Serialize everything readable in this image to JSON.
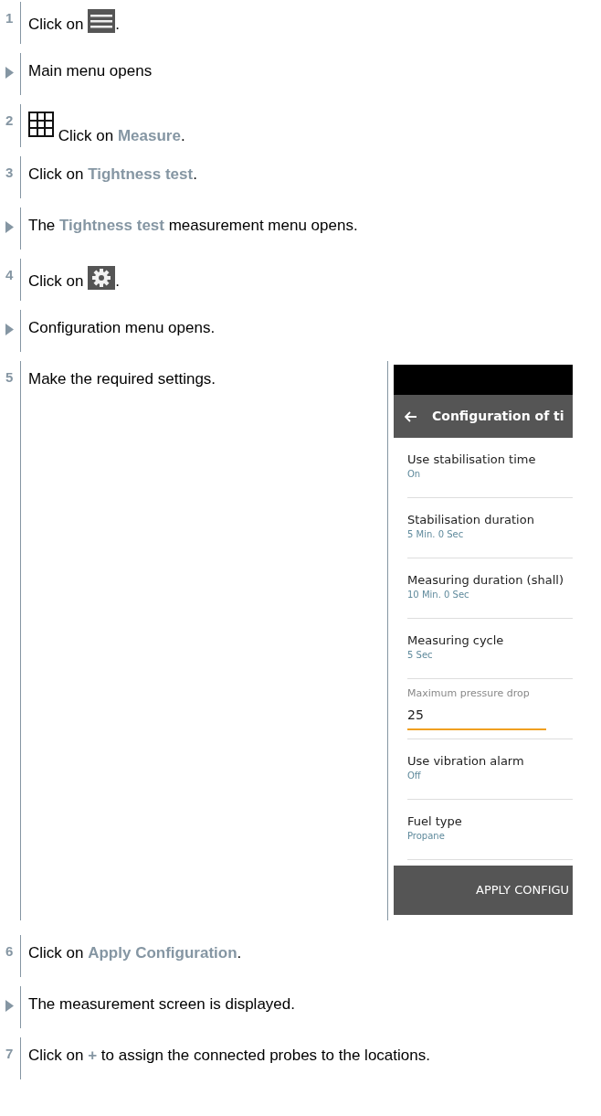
{
  "steps": [
    {
      "kind": "step",
      "number": "1",
      "segments": [
        {
          "text": "Click on "
        },
        {
          "kind": "menu"
        },
        {
          "text": "."
        }
      ]
    },
    {
      "kind": "result",
      "segments": [
        {
          "text": "Main menu opens"
        }
      ]
    },
    {
      "kind": "step",
      "number": "2",
      "segments": [
        {
          "kind": "grid"
        },
        {
          "text": " Click on **Measure**."
        }
      ]
    },
    {
      "kind": "step",
      "number": "3",
      "segments": [
        {
          "text": "Click on **Tightness test**."
        }
      ]
    },
    {
      "kind": "result",
      "segments": [
        {
          "text": "The **Tightness test** measurement menu opens."
        }
      ]
    },
    {
      "kind": "step",
      "number": "4",
      "segments": [
        {
          "text": "Click on "
        },
        {
          "kind": "gear"
        },
        {
          "text": "."
        }
      ]
    },
    {
      "kind": "result",
      "segments": [
        {
          "text": "Configuration menu opens."
        }
      ]
    },
    {
      "kind": "step",
      "number": "5",
      "segments": [
        {
          "text": "Make the required settings."
        }
      ],
      "screenshot": {
        "header": {
          "title": "Configuration of ti"
        },
        "settings": [
          {
            "kind": "item",
            "label": "Use stabilisation time",
            "value": "On"
          },
          {
            "kind": "item",
            "label": "Stabilisation duration",
            "value": "5 Min. 0 Sec"
          },
          {
            "kind": "item",
            "label": "Measuring duration (shall)",
            "value": "10 Min. 0 Sec"
          },
          {
            "kind": "item",
            "label": "Measuring cycle",
            "value": "5 Sec"
          },
          {
            "kind": "field",
            "label": "Maximum pressure drop",
            "value": "25"
          },
          {
            "kind": "item",
            "label": "Use vibration alarm",
            "value": "Off"
          },
          {
            "kind": "item",
            "label": "Fuel type",
            "value": "Propane"
          }
        ],
        "button": "APPLY CONFIGU"
      }
    },
    {
      "kind": "step",
      "number": "6",
      "segments": [
        {
          "text": "Click on **Apply Configuration**."
        }
      ]
    },
    {
      "kind": "result",
      "segments": [
        {
          "text": "The measurement screen is displayed."
        }
      ]
    },
    {
      "kind": "step",
      "number": "7",
      "segments": [
        {
          "text": "Click on **+** to assign the connected probes to the locations."
        }
      ]
    }
  ]
}
